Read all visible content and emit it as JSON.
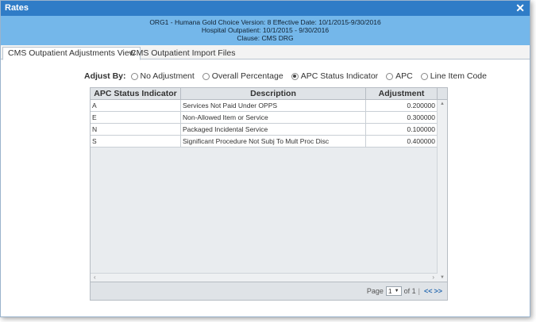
{
  "window": {
    "title": "Rates",
    "close_label": "✕"
  },
  "info": {
    "line1": "ORG1 - Humana Gold Choice Version: 8 Effective Date: 10/1/2015-9/30/2016",
    "line2": "Hospital Outpatient: 10/1/2015 - 9/30/2016",
    "line3": "Clause: CMS DRG"
  },
  "tabs": [
    {
      "label": "CMS Outpatient Adjustments View",
      "active": true
    },
    {
      "label": "CMS Outpatient Import Files",
      "active": false
    }
  ],
  "adjust_by": {
    "label": "Adjust By:",
    "options": [
      {
        "label": "No Adjustment",
        "checked": false
      },
      {
        "label": "Overall Percentage",
        "checked": false
      },
      {
        "label": "APC Status Indicator",
        "checked": true
      },
      {
        "label": "APC",
        "checked": false
      },
      {
        "label": "Line Item Code",
        "checked": false
      }
    ]
  },
  "grid": {
    "columns": [
      "APC Status Indicator",
      "Description",
      "Adjustment"
    ],
    "rows": [
      {
        "indicator": "A",
        "description": "Services Not Paid Under OPPS",
        "adjustment": "0.200000"
      },
      {
        "indicator": "E",
        "description": "Non-Allowed Item or Service",
        "adjustment": "0.300000"
      },
      {
        "indicator": "N",
        "description": "Packaged Incidental Service",
        "adjustment": "0.100000"
      },
      {
        "indicator": "S",
        "description": "Significant Procedure Not Subj To Mult Proc Disc",
        "adjustment": "0.400000"
      }
    ]
  },
  "pager": {
    "page_label": "Page",
    "current_page": "1",
    "of_label": "of 1",
    "separator": "|",
    "prev": "<<",
    "next": ">>"
  }
}
